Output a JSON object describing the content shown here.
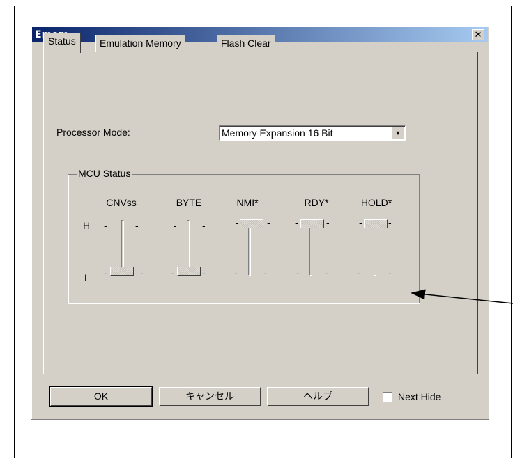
{
  "dialog": {
    "title": "Emem",
    "close_glyph": "✕"
  },
  "tabs": [
    {
      "label": "Status",
      "active": true
    },
    {
      "label": "Emulation Memory",
      "active": false
    },
    {
      "label": "Flash Clear",
      "active": false
    }
  ],
  "processor_mode": {
    "label": "Processor Mode:",
    "selected": "Memory Expansion 16 Bit"
  },
  "mcu_status": {
    "title": "MCU Status",
    "high_label": "H",
    "low_label": "L",
    "signals": [
      {
        "name": "CNVss",
        "level": "L"
      },
      {
        "name": "BYTE",
        "level": "L"
      },
      {
        "name": "NMI*",
        "level": "H"
      },
      {
        "name": "RDY*",
        "level": "H"
      },
      {
        "name": "HOLD*",
        "level": "H"
      }
    ]
  },
  "buttons": {
    "ok": "OK",
    "cancel": "キャンセル",
    "help": "ヘルプ"
  },
  "next_hide": {
    "label": "Next Hide",
    "checked": false
  },
  "colors": {
    "face": "#d4d0c8",
    "title_start": "#0a246a",
    "title_end": "#a6caf0"
  }
}
